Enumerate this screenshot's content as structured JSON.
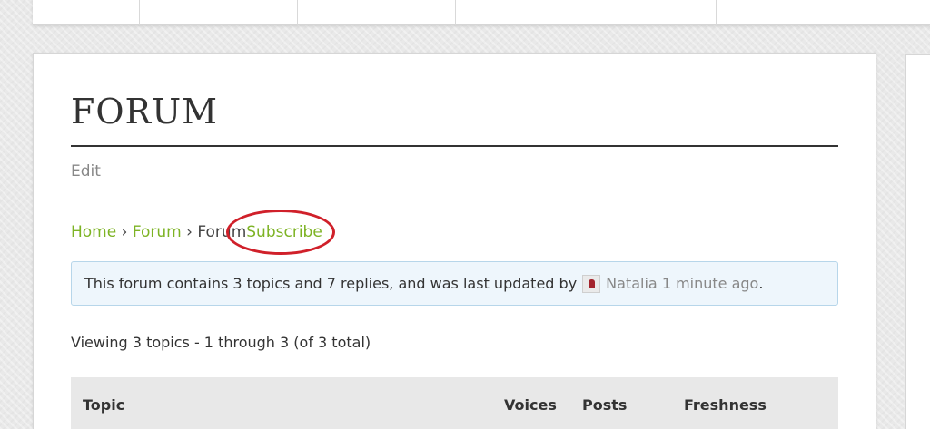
{
  "page": {
    "title": "FORUM",
    "edit_label": "Edit"
  },
  "breadcrumb": {
    "home": "Home",
    "separator": "›",
    "forum_link": "Forum",
    "current": "Forum",
    "subscribe": "Subscribe"
  },
  "notice": {
    "text_before": "This forum contains 3 topics and 7 replies, and was last updated by",
    "author": "Natalia",
    "time": "1 minute ago",
    "text_after": "."
  },
  "viewing": "Viewing 3 topics - 1 through 3 (of 3 total)",
  "table": {
    "columns": [
      "Topic",
      "Voices",
      "Posts",
      "Freshness"
    ]
  },
  "colors": {
    "link": "#7db324",
    "annotation_circle": "#d0202a",
    "notice_bg": "#eef6fc"
  }
}
